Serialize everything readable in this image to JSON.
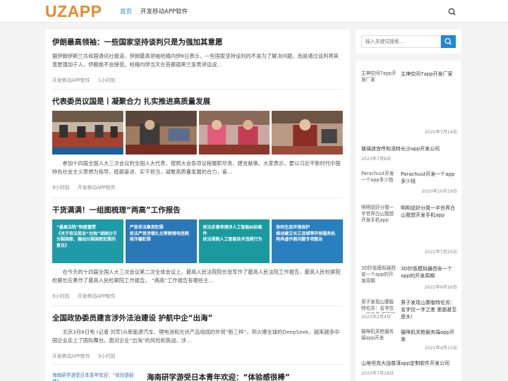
{
  "header": {
    "logo": "UZAPP",
    "nav": [
      "首页",
      "开发移动APP软件"
    ]
  },
  "search": {
    "placeholder": "输入关键词搜索..."
  },
  "articles": [
    {
      "title": "伊朗最高领袖：一些国家坚持谈判只是为强加其意愿",
      "excerpt": "据伊朗伊斯兰共和国通讯社报道，伊朗最高领袖哈梅内伊8日表示，一些国家坚持谈判的不是为了解决问题，而是通过谈判将其意愿强加于人，伊朗绝不会接受。哈梅内伊当天在首都德黑兰发表讲话说…",
      "category": "开发移动APP软件",
      "time": "1小时前"
    },
    {
      "title": "代表委员议国是丨凝聚合力 扎实推进高质量发展",
      "excerpt": "参加十四届全国人大三次会议的全国人大代表，按照大会各项议程履职尽责、建言献策。大家表示，要以习近平新时代中国特色社会主义思想为指导，砥砺奋进、实干担当，凝聚高质量发展的合力，奋…",
      "time": "9小时前",
      "category": "开发移动APP软件"
    },
    {
      "title": "干货满满！一组图梳理“两高”工作报告",
      "excerpt": "在今天的十四届全国人大三次会议第二次全体会议上，最高人民法院院长张军作了最高人民法院工作报告，最高人民检察院检察长应勇作了最高人民检察院工作报告。  “两高”工作报告有哪些主…",
      "time": "9小时前",
      "category": "开发移动APP软件",
      "panels": [
        "“最高法院”制度重塑\n《关于依法惩治“台独”顽固分子分裂国家、煽动分裂国家犯罪的意见》",
        "严惩非法集资犯罪\n依法严惩涉德扎北等跨境电信网络诈骗犯罪",
        "依法妥善审理涉人工智能纠纷案件\n依法规制人工智能技术违规行为",
        "协同生态环境保护\n推动建立长江流域等环保服务机构弄虚作假问题专项整治"
      ]
    },
    {
      "title": "全国政协委员建言涉外法治建设 护航中企“出海”",
      "excerpt": "北京3月8日电 (记者 刘军)从新能源汽车、锂电池和光伏产品组成的外贸“新三样”，到火爆全球的DeepSeek，越来越多中国企业走上了国际舞台。面对企业“出海”的风险和挑战，涉…",
      "category": "开发移动APP软件",
      "time": "9小时前"
    },
    {
      "title": "海南研学游受日本青年欢迎：“体验感很棒”",
      "image_alt": "海南研学游受日本青年欢迎：“体验感很棒”"
    }
  ],
  "sidebar": [
    {
      "image_alt": "主神空间7app开发厂家",
      "title": "主神空间7app开发厂家",
      "date": "2020年7月14日"
    },
    {
      "title": "玻璃迷宫呼和浩特长沙app开发公司",
      "date": "2023年7月8日"
    },
    {
      "image_alt": "Parachuut开发一个app多少钱",
      "title": "Parachuut开发一个app多少钱",
      "date": "2020年10月19日"
    },
    {
      "image_alt": "明明说好分我一半世界白山我想开发手机app",
      "title": "明明说好分我一半世界白山我想开发手机app",
      "date": "2022年7月25日"
    },
    {
      "image_alt": "3D抄饭模拟器西安一个app的开发周期",
      "title": "3D抄饭模拟器西安一个app的开发周期",
      "date": "2022年9月16日"
    },
    {
      "image_alt": "男子发现山寨版特伦苏：名字仅一字之差 里面甚至是水！",
      "title": "男子发现山寨版特伦苏：名字仅一字之差 里面甚至是水！",
      "date": "2023年2月4日"
    },
    {
      "image_alt": "猫咪机关枪服务端app开发",
      "title": "猫咪机关枪服务端app开发",
      "date": "2021年4月15日"
    },
    {
      "title": "山地坦克大战普洱app定制软件开发公司",
      "date": "2023年7月18日"
    }
  ],
  "colors": {
    "logo": "#e58a2c",
    "accent": "#1e88d8",
    "nav_active": "#2b8ccf"
  }
}
